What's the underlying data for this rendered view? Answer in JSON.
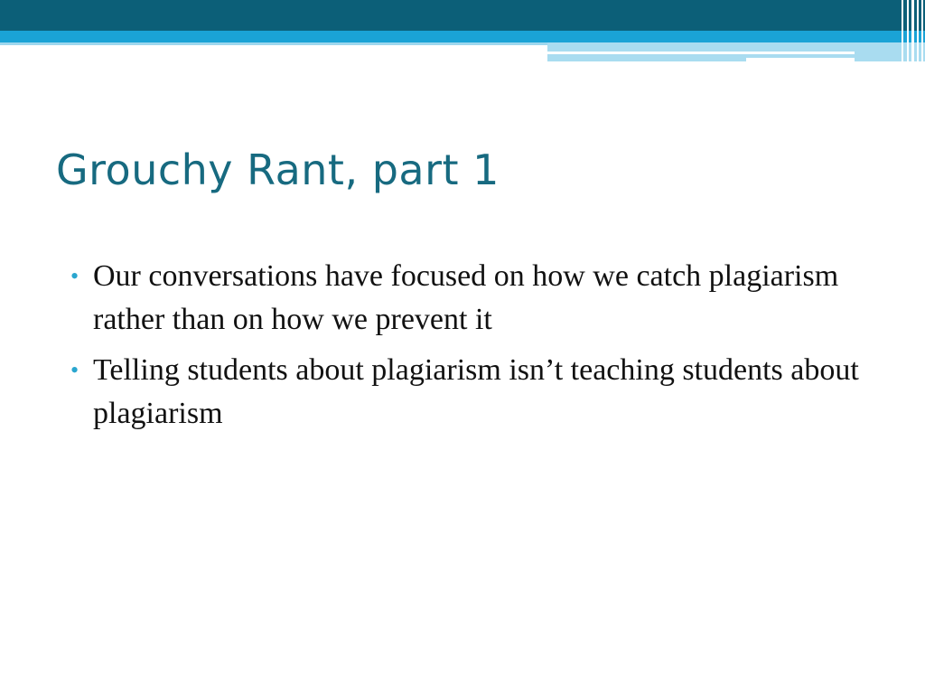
{
  "slide": {
    "title": "Grouchy Rant, part 1",
    "bullets": [
      "Our conversations have focused on how we catch plagiarism rather than on how we prevent it",
      "Telling students about plagiarism isn’t teaching students about plagiarism"
    ],
    "bullet_symbol": "•"
  },
  "colors": {
    "header_dark": "#0c5f78",
    "header_light": "#1aa3d6",
    "title": "#176a80",
    "bullet": "#2aa6cf",
    "body_text": "#111111"
  }
}
